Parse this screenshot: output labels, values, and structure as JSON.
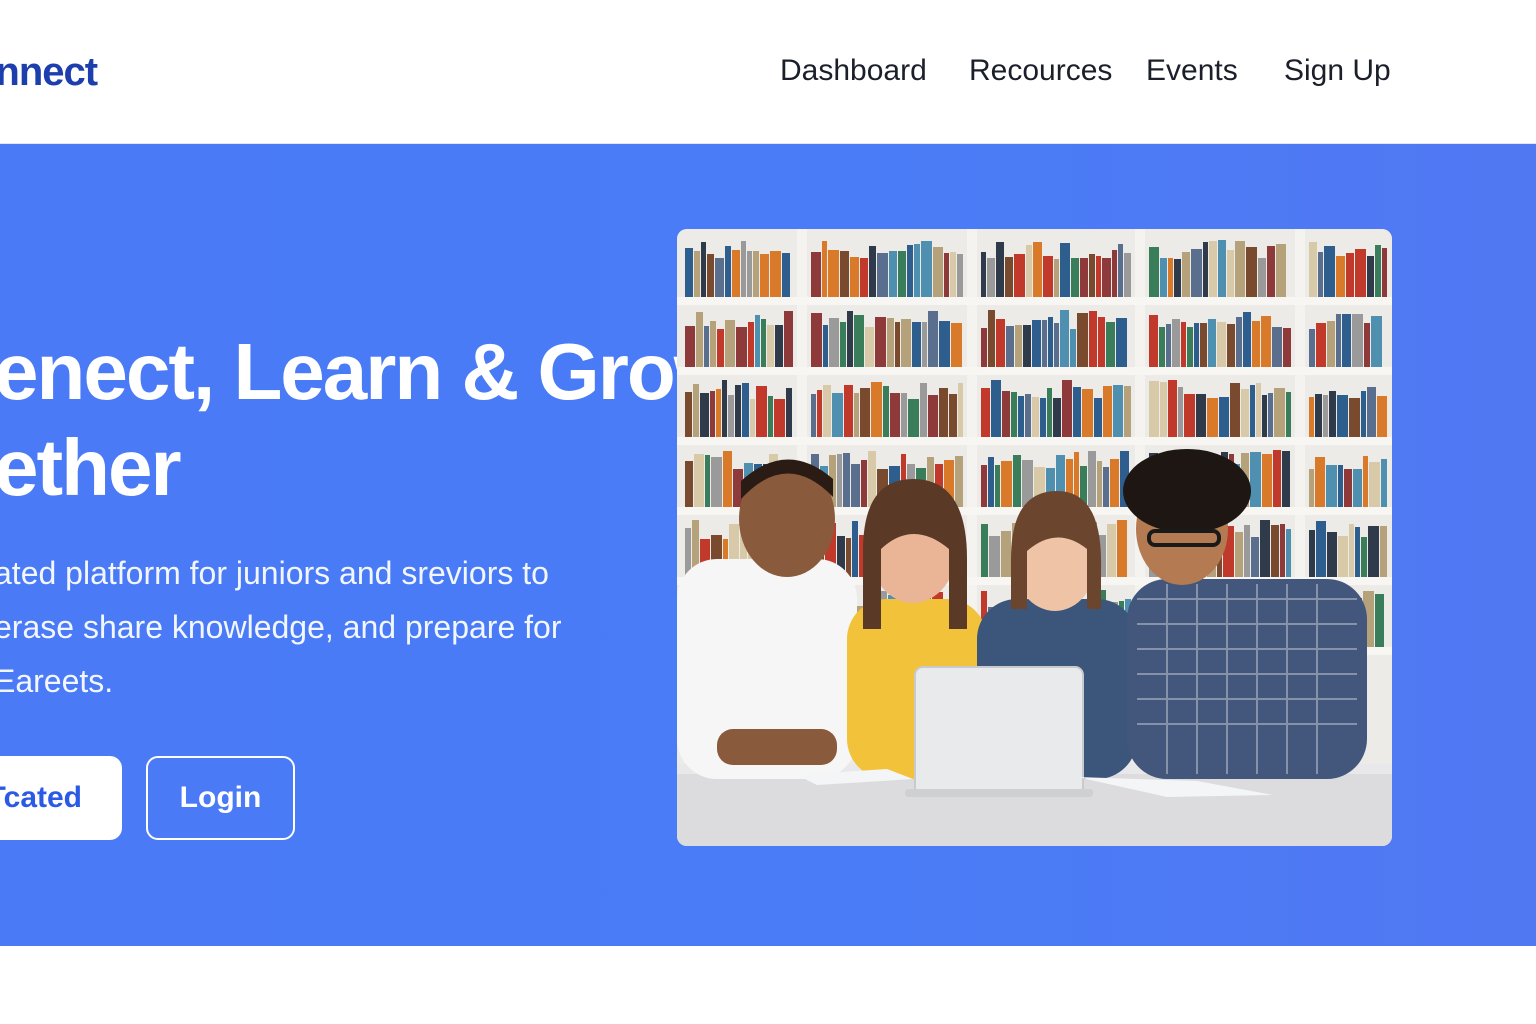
{
  "header": {
    "logo": "onnect",
    "nav": [
      "Dashboard",
      "Recources",
      "Events",
      "Sign Up"
    ]
  },
  "hero": {
    "title_lines": [
      "enect, Learn & Grow",
      "ether"
    ],
    "description_lines": [
      "ated platform for juniors and sreviors to",
      "erase share knowledge, and prepare for",
      "Eareets."
    ],
    "primary_button": "Tcated",
    "secondary_button": "Login",
    "image_icon": "students-with-laptop-photo"
  },
  "colors": {
    "brand": "#1d3fae",
    "hero_bg": "#4a7af6",
    "primary_button_text": "#2a5ae6",
    "nav_text": "#1b1f2a"
  }
}
